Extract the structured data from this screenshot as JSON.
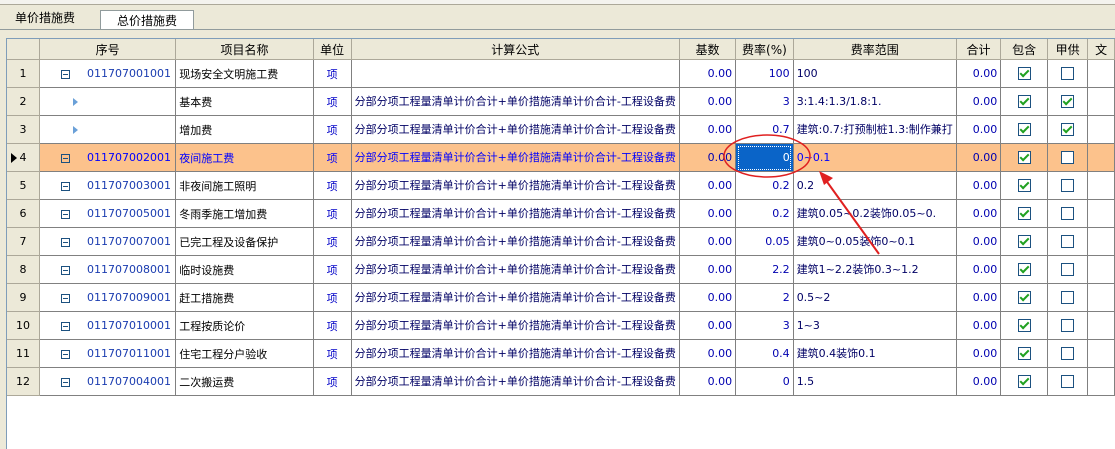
{
  "tabs": [
    {
      "label": "单价措施费",
      "active": false
    },
    {
      "label": "总价措施费",
      "active": true
    }
  ],
  "columns": {
    "seq": "序号",
    "name": "项目名称",
    "unit": "单位",
    "formula": "计算公式",
    "base": "基数",
    "rate": "费率(%)",
    "range": "费率范围",
    "total": "合计",
    "include": "包含",
    "owner_supply": "甲供",
    "text": "文"
  },
  "rows": [
    {
      "idx": "1",
      "code": "011707001001",
      "name": "现场安全文明施工费",
      "unit": "项",
      "formula": "",
      "base": "0.00",
      "rate": "100",
      "range": "100",
      "total": "0.00",
      "include": true,
      "owner": false,
      "node": "collapse"
    },
    {
      "idx": "2",
      "code": "",
      "name": "基本费",
      "unit": "项",
      "formula": "分部分项工程量清单计价合计+单价措施清单计价合计-工程设备费",
      "base": "0.00",
      "rate": "3",
      "range": "3:1.4:1.3/1.8:1.",
      "total": "0.00",
      "include": true,
      "owner": true,
      "node": "child"
    },
    {
      "idx": "3",
      "code": "",
      "name": "增加费",
      "unit": "项",
      "formula": "分部分项工程量清单计价合计+单价措施清单计价合计-工程设备费",
      "base": "0.00",
      "rate": "0.7",
      "range": "建筑:0.7:打预制桩1.3:制作兼打",
      "total": "0.00",
      "include": true,
      "owner": true,
      "node": "child"
    },
    {
      "idx": "4",
      "code": "011707002001",
      "name": "夜间施工费",
      "unit": "项",
      "formula": "分部分项工程量清单计价合计+单价措施清单计价合计-工程设备费",
      "base": "0.00",
      "rate": "0",
      "range": "0~0.1",
      "total": "0.00",
      "include": true,
      "owner": false,
      "node": "collapse",
      "selected": true
    },
    {
      "idx": "5",
      "code": "011707003001",
      "name": "非夜间施工照明",
      "unit": "项",
      "formula": "分部分项工程量清单计价合计+单价措施清单计价合计-工程设备费",
      "base": "0.00",
      "rate": "0.2",
      "range": "0.2",
      "total": "0.00",
      "include": true,
      "owner": false,
      "node": "collapse"
    },
    {
      "idx": "6",
      "code": "011707005001",
      "name": "冬雨季施工增加费",
      "unit": "项",
      "formula": "分部分项工程量清单计价合计+单价措施清单计价合计-工程设备费",
      "base": "0.00",
      "rate": "0.2",
      "range": "建筑0.05~0.2装饰0.05~0.",
      "total": "0.00",
      "include": true,
      "owner": false,
      "node": "collapse"
    },
    {
      "idx": "7",
      "code": "011707007001",
      "name": "已完工程及设备保护",
      "unit": "项",
      "formula": "分部分项工程量清单计价合计+单价措施清单计价合计-工程设备费",
      "base": "0.00",
      "rate": "0.05",
      "range": "建筑0~0.05装饰0~0.1",
      "total": "0.00",
      "include": true,
      "owner": false,
      "node": "collapse"
    },
    {
      "idx": "8",
      "code": "011707008001",
      "name": "临时设施费",
      "unit": "项",
      "formula": "分部分项工程量清单计价合计+单价措施清单计价合计-工程设备费",
      "base": "0.00",
      "rate": "2.2",
      "range": "建筑1~2.2装饰0.3~1.2",
      "total": "0.00",
      "include": true,
      "owner": false,
      "node": "collapse"
    },
    {
      "idx": "9",
      "code": "011707009001",
      "name": "赶工措施费",
      "unit": "项",
      "formula": "分部分项工程量清单计价合计+单价措施清单计价合计-工程设备费",
      "base": "0.00",
      "rate": "2",
      "range": "0.5~2",
      "total": "0.00",
      "include": true,
      "owner": false,
      "node": "collapse"
    },
    {
      "idx": "10",
      "code": "011707010001",
      "name": "工程按质论价",
      "unit": "项",
      "formula": "分部分项工程量清单计价合计+单价措施清单计价合计-工程设备费",
      "base": "0.00",
      "rate": "3",
      "range": "1~3",
      "total": "0.00",
      "include": true,
      "owner": false,
      "node": "collapse"
    },
    {
      "idx": "11",
      "code": "011707011001",
      "name": "住宅工程分户验收",
      "unit": "项",
      "formula": "分部分项工程量清单计价合计+单价措施清单计价合计-工程设备费",
      "base": "0.00",
      "rate": "0.4",
      "range": "建筑0.4装饰0.1",
      "total": "0.00",
      "include": true,
      "owner": false,
      "node": "collapse"
    },
    {
      "idx": "12",
      "code": "011707004001",
      "name": "二次搬运费",
      "unit": "项",
      "formula": "分部分项工程量清单计价合计+单价措施清单计价合计-工程设备费",
      "base": "0.00",
      "rate": "0",
      "range": "1.5",
      "total": "0.00",
      "include": true,
      "owner": false,
      "node": "collapse"
    }
  ],
  "annotation": {
    "color": "#e02020"
  }
}
